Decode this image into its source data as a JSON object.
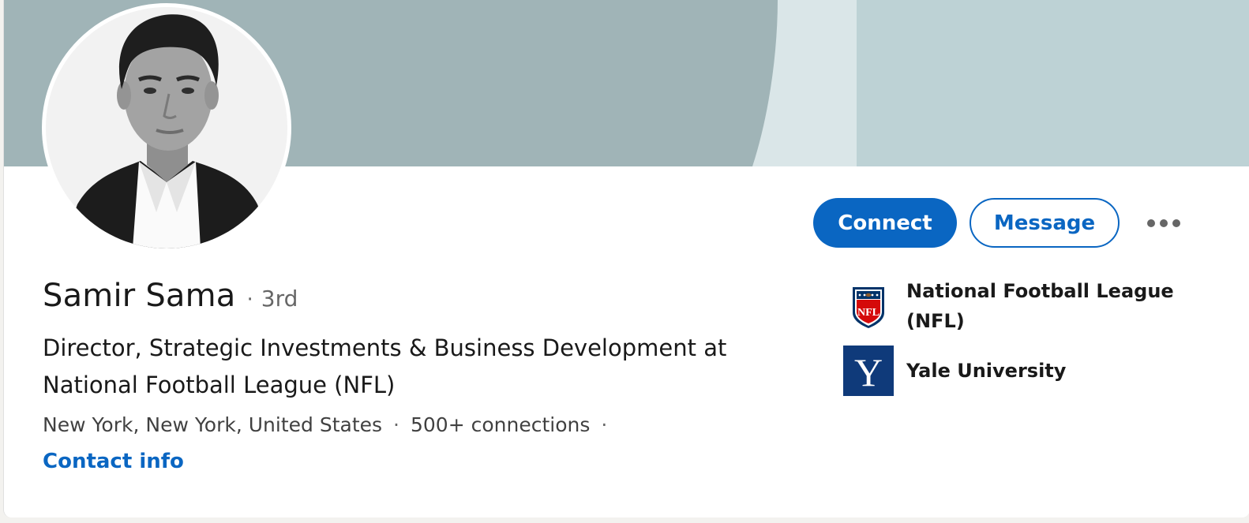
{
  "profile": {
    "name": "Samir Sama",
    "degree_separator": "·",
    "degree": "3rd",
    "headline": "Director, Strategic Investments & Business Development at National Football League (NFL)",
    "location": "New York, New York, United States",
    "connections": "500+ connections",
    "meta_separator": "·",
    "contact_info_label": "Contact info"
  },
  "actions": {
    "connect_label": "Connect",
    "message_label": "Message",
    "more_icon": "ellipsis-icon"
  },
  "organizations": [
    {
      "name": "National Football League (NFL)",
      "logo_icon": "nfl-logo"
    },
    {
      "name": "Yale University",
      "logo_icon": "yale-logo",
      "logo_text": "Y"
    }
  ],
  "colors": {
    "accent": "#0a66c2",
    "banner_dark": "#a0b4b7",
    "banner_mid": "#dae6e8",
    "banner_light": "#bdd2d5",
    "yale_blue": "#0f3a7a"
  }
}
